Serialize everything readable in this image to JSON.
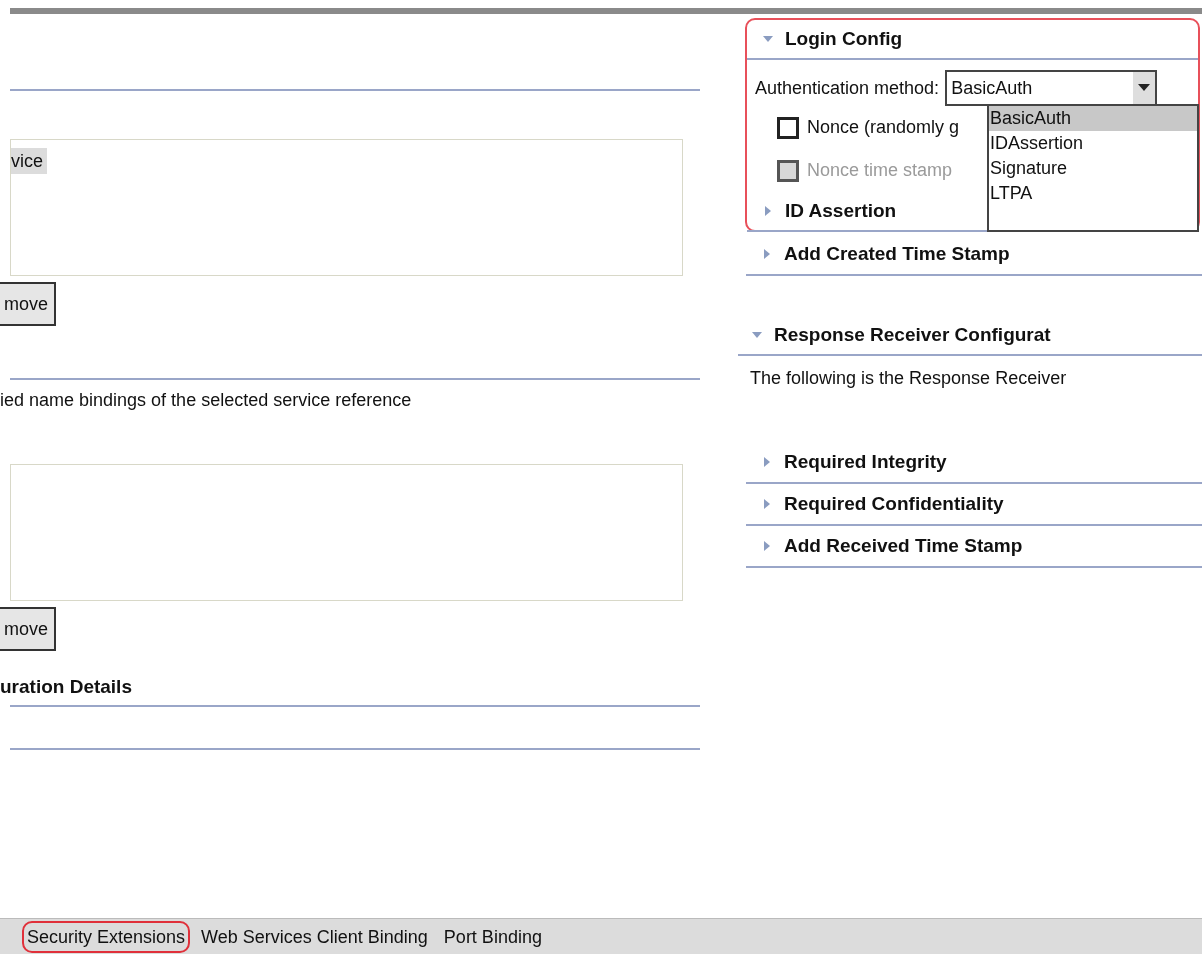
{
  "left_panel": {
    "list_1": {
      "items": [
        {
          "label": "vice",
          "selected": true
        }
      ]
    },
    "remove_button_1": "move",
    "description": "ied name bindings of the selected service reference",
    "remove_button_2": "move",
    "heading": "uration Details"
  },
  "login_config": {
    "title": "Login Config",
    "expanded": true,
    "auth_label": "Authentication method:",
    "auth_value": "BasicAuth",
    "dropdown_options": [
      {
        "label": "BasicAuth",
        "selected": true
      },
      {
        "label": "IDAssertion",
        "selected": false
      },
      {
        "label": "Signature",
        "selected": false
      },
      {
        "label": "LTPA",
        "selected": false
      }
    ],
    "checkboxes": [
      {
        "label": "Nonce (randomly g",
        "checked": false,
        "disabled": false
      },
      {
        "label": "Nonce time stamp",
        "checked": false,
        "disabled": true
      }
    ],
    "subsections": [
      {
        "title": "ID Assertion",
        "expanded": false
      }
    ]
  },
  "sections": [
    {
      "title": "Add Created Time Stamp",
      "expanded": false
    },
    {
      "title": "Response Receiver Configurat",
      "expanded": true,
      "description": "The following is the Response Receiver"
    },
    {
      "title": "Required Integrity",
      "expanded": false
    },
    {
      "title": "Required Confidentiality",
      "expanded": false
    },
    {
      "title": "Add Received Time Stamp",
      "expanded": false
    }
  ],
  "tabs": [
    {
      "label": "Security Extensions",
      "selected": true
    },
    {
      "label": "Web Services Client Binding",
      "selected": false
    },
    {
      "label": "Port Binding",
      "selected": false
    }
  ]
}
